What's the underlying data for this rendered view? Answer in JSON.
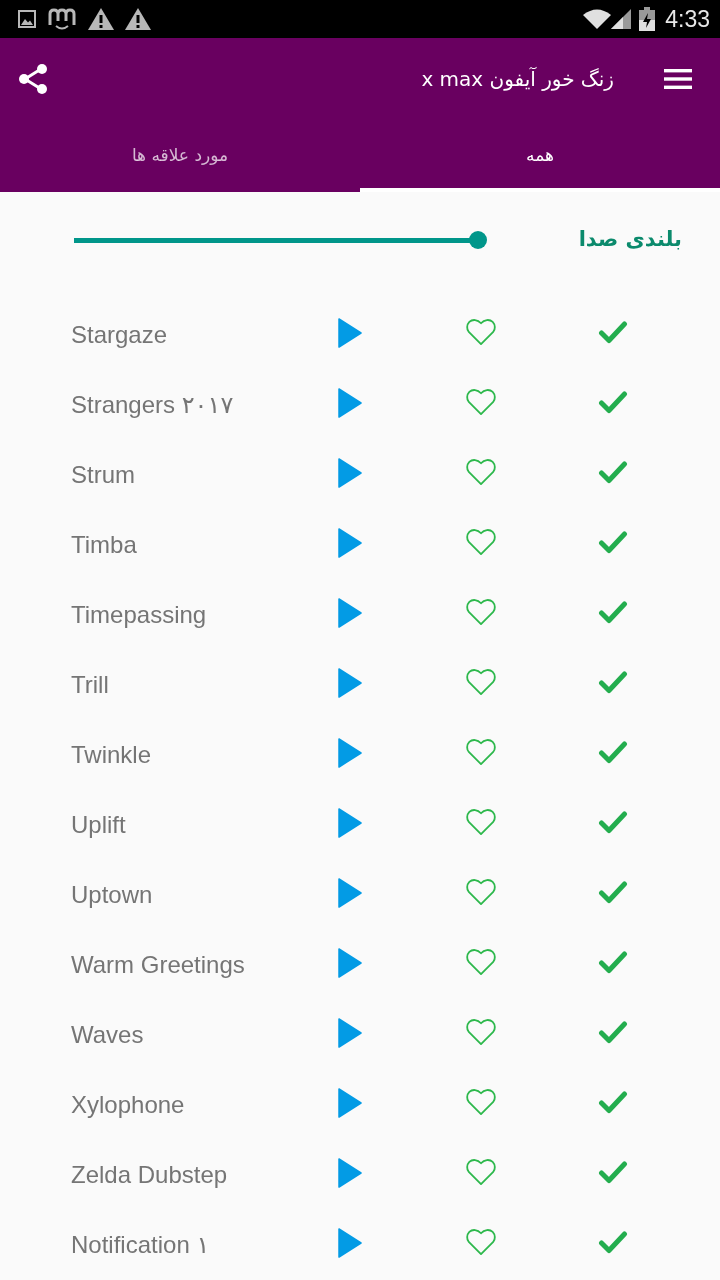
{
  "status_bar": {
    "time": "4:33"
  },
  "app_bar": {
    "title": "زنگ خور آیفون x max"
  },
  "tabs": [
    {
      "label": "همه",
      "selected": true
    },
    {
      "label": "مورد علاقه ها",
      "selected": false
    }
  ],
  "volume": {
    "label": "بلندی صدا",
    "level": 1
  },
  "ringtones": [
    {
      "name": "Stargaze",
      "favorite": false
    },
    {
      "name": "Strangers ۲۰۱۷",
      "favorite": false
    },
    {
      "name": "Strum",
      "favorite": false
    },
    {
      "name": "Timba",
      "favorite": false
    },
    {
      "name": "Timepassing",
      "favorite": false
    },
    {
      "name": "Trill",
      "favorite": false
    },
    {
      "name": "Twinkle",
      "favorite": false
    },
    {
      "name": "Uplift",
      "favorite": false
    },
    {
      "name": "Uptown",
      "favorite": false
    },
    {
      "name": "Warm Greetings",
      "favorite": false
    },
    {
      "name": "Waves",
      "favorite": false
    },
    {
      "name": "Xylophone",
      "favorite": false
    },
    {
      "name": "Zelda Dubstep",
      "favorite": false
    },
    {
      "name": "Notification ۱",
      "favorite": false
    }
  ]
}
